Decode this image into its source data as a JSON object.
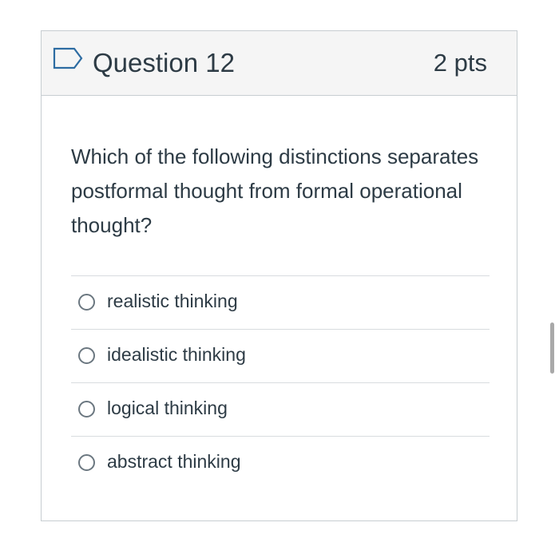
{
  "question": {
    "title": "Question 12",
    "points": "2 pts",
    "text": "Which of the following distinctions separates postformal thought from formal operational thought?",
    "flag_icon": "bookmark-flag-icon",
    "answers": [
      {
        "label": "realistic thinking",
        "selected": false
      },
      {
        "label": "idealistic thinking",
        "selected": false
      },
      {
        "label": "logical thinking",
        "selected": false
      },
      {
        "label": "abstract thinking",
        "selected": false
      }
    ]
  },
  "colors": {
    "text": "#2d3b45",
    "header_bg": "#f5f5f5",
    "border": "#c7cdd1",
    "flag": "#2d6ca2"
  }
}
